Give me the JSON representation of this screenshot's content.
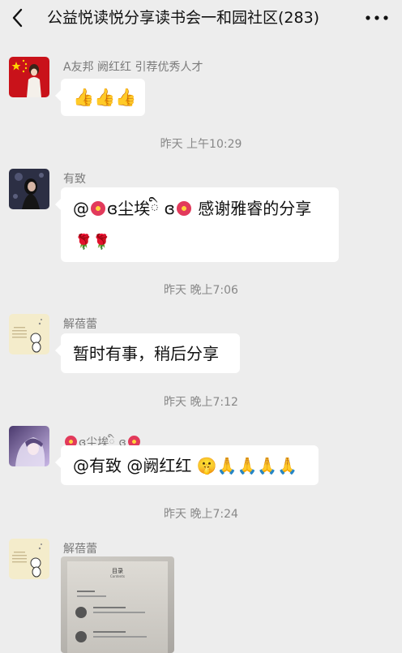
{
  "header": {
    "title": "公益悦读悦分享读书会一和园社区(283)",
    "back_icon": "chevron-left-icon",
    "more_icon": "more-horizontal-icon"
  },
  "messages": [
    {
      "sender": "A友邦 阙红红 引荐优秀人才",
      "avatar_icon": "avatar-flag-person-icon",
      "content": "👍👍👍"
    },
    {
      "time": "昨天 上午10:29",
      "sender": "有致",
      "avatar_icon": "avatar-woman-icon",
      "line1_prefix": "@",
      "line1_mention": "ɞ尘埃ི ɞ",
      "line1_suffix": " 感谢雅睿的分享",
      "line2": "🌹🌹"
    },
    {
      "time": "昨天 晚上7:06",
      "sender": "解蓓蕾",
      "avatar_icon": "avatar-cartoon-icon",
      "content": "暂时有事，稍后分享"
    },
    {
      "time": "昨天 晚上7:12",
      "sender": "ɞ尘埃ི ɞ",
      "avatar_icon": "avatar-anime-icon",
      "content": "@有致  @阙红红 🤫🙏🙏🙏🙏"
    },
    {
      "time": "昨天 晚上7:24",
      "sender": "解蓓蕾",
      "avatar_icon": "avatar-cartoon-icon",
      "image_title": "目录",
      "image_subtitle": "Contents",
      "image_icon": "book-contents-photo"
    }
  ]
}
